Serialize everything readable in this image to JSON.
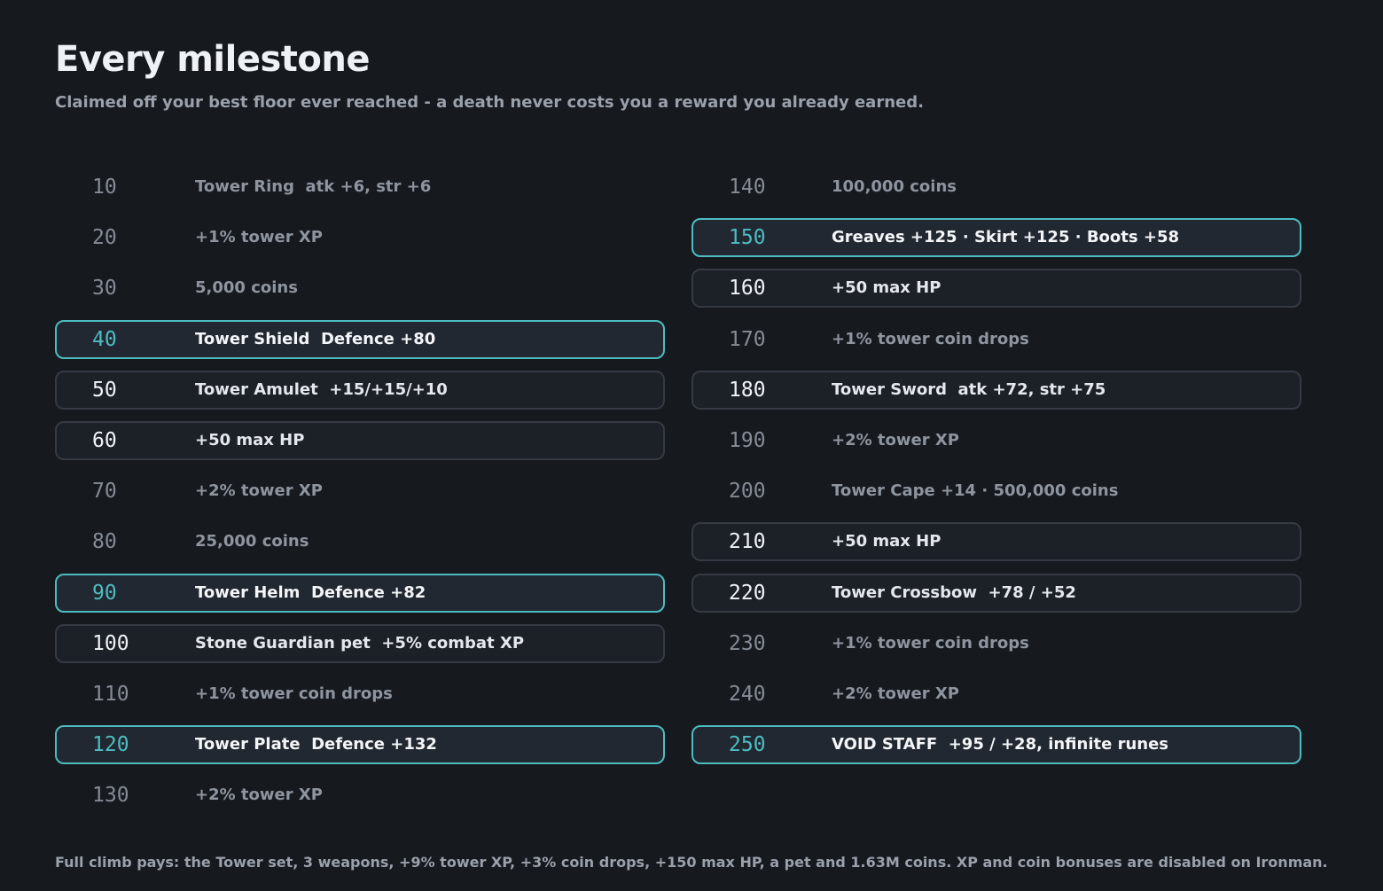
{
  "header": {
    "title": "Every milestone",
    "subtitle": "Claimed off your best floor ever reached - a death never costs you a reward you already earned."
  },
  "milestones_left": [
    {
      "floor": "10",
      "reward": "Tower Ring  atk +6, str +6",
      "style": "plain"
    },
    {
      "floor": "20",
      "reward": "+1% tower XP",
      "style": "plain"
    },
    {
      "floor": "30",
      "reward": "5,000 coins",
      "style": "plain"
    },
    {
      "floor": "40",
      "reward": "Tower Shield  Defence +80",
      "style": "highlight"
    },
    {
      "floor": "50",
      "reward": "Tower Amulet  +15/+15/+10",
      "style": "boxed"
    },
    {
      "floor": "60",
      "reward": "+50 max HP",
      "style": "boxed"
    },
    {
      "floor": "70",
      "reward": "+2% tower XP",
      "style": "plain"
    },
    {
      "floor": "80",
      "reward": "25,000 coins",
      "style": "plain"
    },
    {
      "floor": "90",
      "reward": "Tower Helm  Defence +82",
      "style": "highlight"
    },
    {
      "floor": "100",
      "reward": "Stone Guardian pet  +5% combat XP",
      "style": "boxed"
    },
    {
      "floor": "110",
      "reward": "+1% tower coin drops",
      "style": "plain"
    },
    {
      "floor": "120",
      "reward": "Tower Plate  Defence +132",
      "style": "highlight"
    },
    {
      "floor": "130",
      "reward": "+2% tower XP",
      "style": "plain"
    }
  ],
  "milestones_right": [
    {
      "floor": "140",
      "reward": "100,000 coins",
      "style": "plain"
    },
    {
      "floor": "150",
      "reward": "Greaves +125 · Skirt +125 · Boots +58",
      "style": "highlight"
    },
    {
      "floor": "160",
      "reward": "+50 max HP",
      "style": "boxed"
    },
    {
      "floor": "170",
      "reward": "+1% tower coin drops",
      "style": "plain"
    },
    {
      "floor": "180",
      "reward": "Tower Sword  atk +72, str +75",
      "style": "boxed"
    },
    {
      "floor": "190",
      "reward": "+2% tower XP",
      "style": "plain"
    },
    {
      "floor": "200",
      "reward": "Tower Cape +14 · 500,000 coins",
      "style": "plain"
    },
    {
      "floor": "210",
      "reward": "+50 max HP",
      "style": "boxed"
    },
    {
      "floor": "220",
      "reward": "Tower Crossbow  +78 / +52",
      "style": "boxed"
    },
    {
      "floor": "230",
      "reward": "+1% tower coin drops",
      "style": "plain"
    },
    {
      "floor": "240",
      "reward": "+2% tower XP",
      "style": "plain"
    },
    {
      "floor": "250",
      "reward": "VOID STAFF  +95 / +28, infinite runes",
      "style": "highlight"
    }
  ],
  "footer": {
    "text": "Full climb pays: the Tower set, 3 weapons, +9% tower XP, +3% coin drops, +150 max HP, a pet and 1.63M coins. XP and coin bonuses are disabled on Ironman."
  },
  "colors": {
    "background": "#16191e",
    "accent": "#4dbcc1",
    "muted_text": "#8e959f"
  }
}
